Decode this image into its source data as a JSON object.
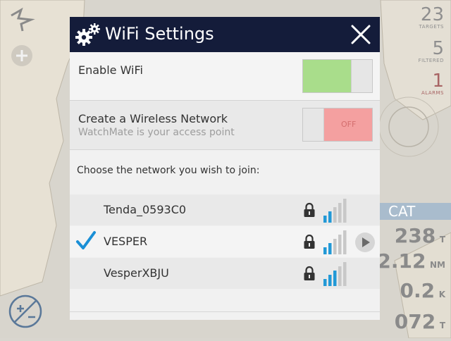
{
  "dialog": {
    "title": "WiFi Settings",
    "enable_wifi": {
      "label": "Enable WiFi",
      "state": "on"
    },
    "wireless_network": {
      "label": "Create a Wireless Network",
      "sublabel": "WatchMate is your access point",
      "state": "off",
      "toggle_text": "OFF"
    },
    "choose_prompt": "Choose the network you wish to join:",
    "networks": [
      {
        "name": "Tenda_0593C0",
        "connected": false,
        "locked": true,
        "signal_bars": 2
      },
      {
        "name": "VESPER",
        "connected": true,
        "locked": true,
        "signal_bars": 2
      },
      {
        "name": "VesperXBJU",
        "connected": false,
        "locked": true,
        "signal_bars": 3
      }
    ]
  },
  "background": {
    "targets": {
      "value": "23",
      "label": "TARGETS"
    },
    "filtered": {
      "value": "5",
      "label": "FILTERED"
    },
    "alarms": {
      "value": "1",
      "label": "ALARMS"
    },
    "target_name": "CAT",
    "readouts": [
      {
        "value": "238",
        "unit": "T"
      },
      {
        "value": "2.12",
        "unit": "NM"
      },
      {
        "value": "0.2",
        "unit": "K"
      },
      {
        "value": "072",
        "unit": "T"
      }
    ]
  },
  "colors": {
    "titlebar": "#141c3a",
    "toggle_on": "#a9dd8b",
    "toggle_off": "#f4a0a0",
    "check": "#1a8fd6",
    "signal_active": "#2299d6",
    "signal_inactive": "#c8c8c8"
  }
}
